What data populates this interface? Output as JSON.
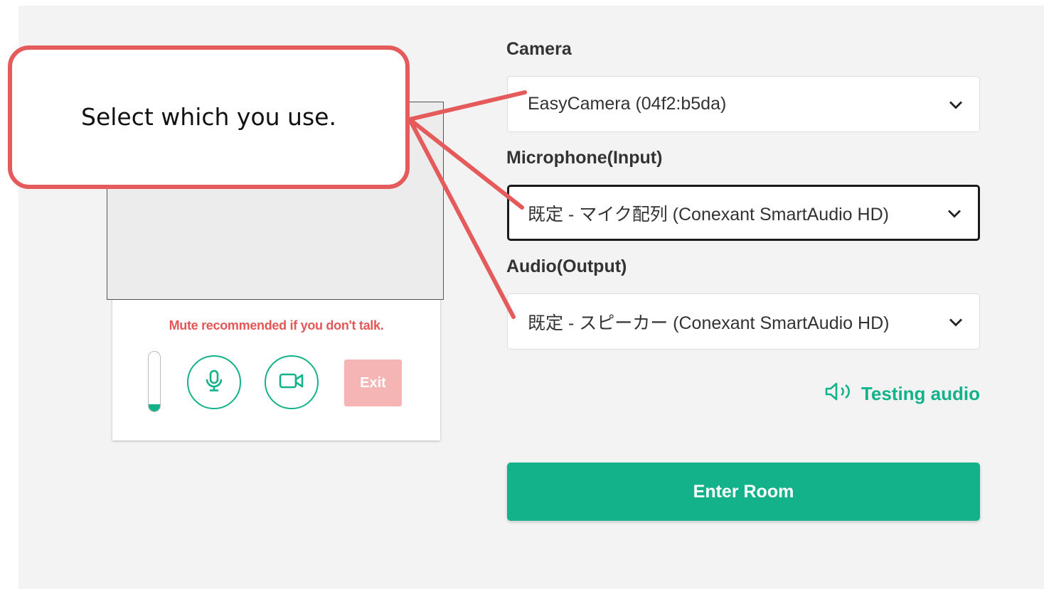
{
  "preview": {
    "mute_note": "Mute recommended if you don't talk.",
    "mic_level": 0.12,
    "exit_label": "Exit"
  },
  "devices": {
    "camera_label": "Camera",
    "camera_value": "EasyCamera (04f2:b5da)",
    "microphone_label": "Microphone(Input)",
    "microphone_value": "既定 - マイク配列 (Conexant SmartAudio HD)",
    "audio_label": "Audio(Output)",
    "audio_value": "既定 - スピーカー (Conexant SmartAudio HD)"
  },
  "testing_audio_label": "Testing audio",
  "enter_room_label": "Enter Room",
  "callout_text": "Select which you use.",
  "colors": {
    "accent": "#13b28a",
    "warning": "#e35757",
    "callout_border": "#e55b5b",
    "exit_disabled": "#f5b5b5"
  },
  "icons": [
    "microphone-icon",
    "video-camera-icon",
    "chevron-down-icon",
    "speaker-icon"
  ]
}
